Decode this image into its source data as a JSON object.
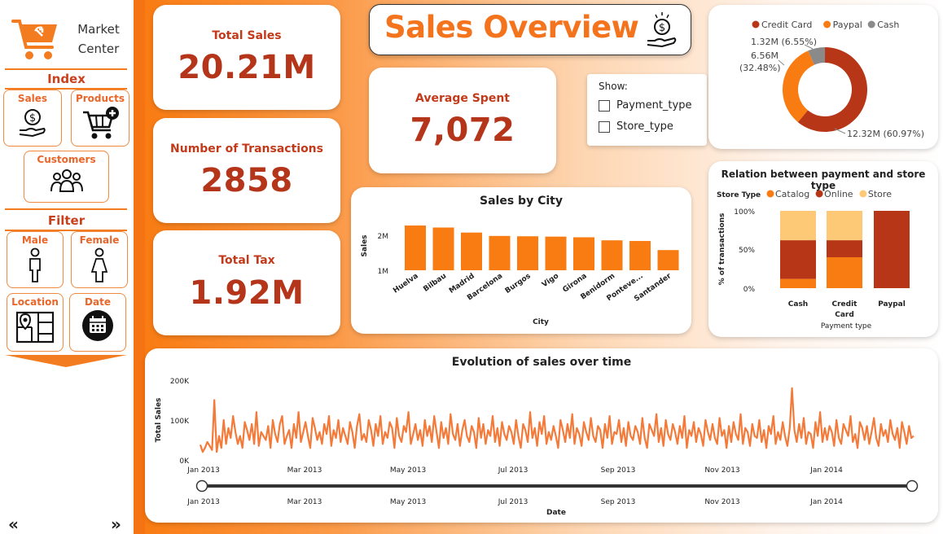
{
  "sidebar": {
    "logo_line1": "Market",
    "logo_line2": "Center",
    "index_title": "Index",
    "filter_title": "Filter",
    "buttons": {
      "sales": "Sales",
      "products": "Products",
      "customers": "Customers",
      "male": "Male",
      "female": "Female",
      "location": "Location",
      "date": "Date"
    },
    "nav_prev": "«",
    "nav_next": "»"
  },
  "header": {
    "title": "Sales Overview"
  },
  "kpis": {
    "total_sales_label": "Total Sales",
    "total_sales_value": "20.21M",
    "transactions_label": "Number of Transactions",
    "transactions_value": "2858",
    "tax_label": "Total Tax",
    "tax_value": "1.92M",
    "avg_label": "Average Spent",
    "avg_value": "7,072"
  },
  "show_panel": {
    "title": "Show:",
    "options": [
      "Payment_type",
      "Store_type"
    ]
  },
  "colors": {
    "orange": "#f97c12",
    "dark_red": "#b5351b",
    "light_orange": "#fdc977",
    "gray": "#8a8a8a"
  },
  "chart_data": [
    {
      "type": "pie",
      "variant": "donut",
      "categories": [
        "Credit Card",
        "Paypal",
        "Cash"
      ],
      "values": [
        12.32,
        6.56,
        1.32
      ],
      "percents": [
        60.97,
        32.48,
        6.55
      ],
      "data_labels": [
        "12.32M (60.97%)",
        "6.56M (32.48%)",
        "1.32M (6.55%)"
      ],
      "colors": [
        "#b83618",
        "#f97c12",
        "#8a8a8a"
      ],
      "legend": "top"
    },
    {
      "type": "bar",
      "title": "Sales by City",
      "categories": [
        "Huelva",
        "Bilbau",
        "Madrid",
        "Barcelona",
        "Burgos",
        "Vigo",
        "Girona",
        "Benidorm",
        "Ponteve...",
        "Santander"
      ],
      "values": [
        2.33,
        2.27,
        2.12,
        2.02,
        2.01,
        2.0,
        1.98,
        1.89,
        1.87,
        1.6
      ],
      "xlabel": "City",
      "ylabel": "Sales",
      "yticks": [
        "1M",
        "2M"
      ],
      "ylim": [
        1.0,
        2.5
      ],
      "color": "#f97c12"
    },
    {
      "type": "bar",
      "variant": "stacked-100",
      "title": "Relation between payment and store type",
      "legend_title": "Store Type",
      "categories": [
        "Cash",
        "Credit Card",
        "Paypal"
      ],
      "series": [
        {
          "name": "Catalog",
          "values": [
            12,
            40,
            0
          ],
          "color": "#f97c12"
        },
        {
          "name": "Online",
          "values": [
            50,
            22,
            100
          ],
          "color": "#b83618"
        },
        {
          "name": "Store",
          "values": [
            38,
            38,
            0
          ],
          "color": "#fdc977"
        }
      ],
      "xlabel": "Payment type",
      "ylabel": "% of transactions",
      "yticks": [
        "0%",
        "50%",
        "100%"
      ],
      "ylim": [
        0,
        100
      ]
    },
    {
      "type": "line",
      "title": "Evolution of sales over time",
      "xlabel": "Date",
      "ylabel": "Total Sales",
      "yticks": [
        "0K",
        "100K",
        "200K"
      ],
      "ylim": [
        0,
        200
      ],
      "xticks": [
        "Jan 2013",
        "Mar 2013",
        "May 2013",
        "Jul 2013",
        "Sep 2013",
        "Nov 2013",
        "Jan 2014"
      ],
      "color": "#f47a3a",
      "values": [
        38,
        20,
        30,
        45,
        35,
        25,
        150,
        20,
        60,
        30,
        100,
        40,
        80,
        55,
        110,
        70,
        40,
        60,
        30,
        95,
        75,
        50,
        90,
        40,
        120,
        35,
        70,
        60,
        50,
        85,
        30,
        100,
        65,
        45,
        90,
        110,
        40,
        60,
        75,
        30,
        90,
        55,
        120,
        45,
        70,
        95,
        60,
        30,
        105,
        80,
        50,
        70,
        40,
        90,
        65,
        110,
        35,
        75,
        55,
        100,
        45,
        80,
        60,
        40,
        95,
        70,
        30,
        85,
        115,
        50,
        65,
        45,
        100,
        75,
        35,
        90,
        60,
        110,
        40,
        70,
        55,
        95,
        80,
        30,
        105,
        60,
        45,
        85,
        70,
        120,
        40,
        65,
        90,
        50,
        75,
        35,
        100,
        60,
        85,
        45,
        110,
        70,
        30,
        95,
        55,
        80,
        40,
        115,
        65,
        50,
        90,
        35,
        75,
        100,
        60,
        45,
        85,
        70,
        30,
        105,
        55,
        90,
        40,
        75,
        60,
        110,
        45,
        80,
        35,
        95,
        65,
        50,
        85,
        70,
        40,
        100,
        60,
        30,
        90,
        75,
        45,
        120,
        55,
        80,
        35,
        95,
        65,
        110,
        40,
        70,
        50,
        85,
        60,
        30,
        100,
        75,
        45,
        90,
        55,
        115,
        40,
        80,
        65,
        35,
        95,
        70,
        50,
        105,
        60,
        45,
        85,
        75,
        30,
        90,
        55,
        110,
        40,
        70,
        65,
        100,
        45,
        80,
        35,
        95,
        60,
        50,
        85,
        70,
        40,
        105,
        55,
        30,
        90,
        75,
        60,
        115,
        45,
        80,
        35,
        100,
        65,
        50,
        90,
        70,
        40,
        85,
        55,
        110,
        30,
        75,
        60,
        95,
        45,
        80,
        65,
        35,
        100,
        70,
        50,
        90,
        55,
        40,
        105,
        60,
        75,
        30,
        85,
        45,
        95,
        65,
        50,
        115,
        40,
        80,
        70,
        35,
        90,
        60,
        55,
        100,
        45,
        75,
        30,
        85,
        65,
        110,
        40,
        70,
        50,
        95,
        60,
        35,
        80,
        180,
        75,
        45,
        90,
        55,
        105,
        40,
        70,
        65,
        30,
        95,
        60,
        120,
        45,
        80,
        50,
        85,
        70,
        35,
        100,
        55,
        40,
        90,
        75,
        60,
        110,
        45,
        65,
        30,
        95,
        80,
        50,
        85,
        40,
        70,
        105,
        55,
        35,
        90,
        60,
        75,
        45,
        100,
        65,
        50,
        80,
        30,
        95,
        70,
        40,
        85,
        55,
        60
      ]
    }
  ],
  "time_slider": {
    "xticks": [
      "Jan 2013",
      "Mar 2013",
      "May 2013",
      "Jul 2013",
      "Sep 2013",
      "Nov 2013",
      "Jan 2014"
    ],
    "xlabel": "Date"
  }
}
